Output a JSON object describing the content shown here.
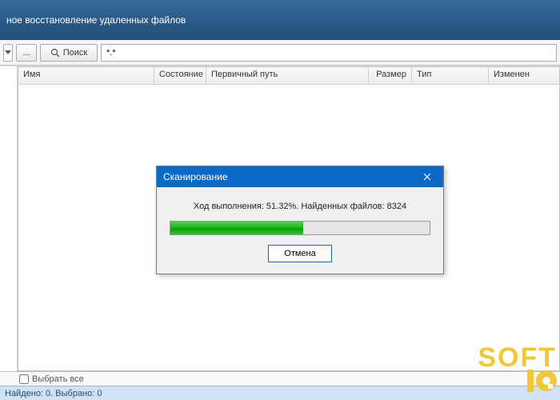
{
  "header": {
    "title": "ное восстановление удаленных файлов"
  },
  "toolbar": {
    "browse_label": "...",
    "search_label": "Поиск",
    "filter_value": "*.*"
  },
  "grid": {
    "columns": {
      "name": "Имя",
      "state": "Состояние",
      "path": "Первичный путь",
      "size": "Размер",
      "type": "Тип",
      "modified": "Изменен"
    }
  },
  "selectall": {
    "label": "Выбрать все",
    "checked": false
  },
  "status": {
    "text": "Найдено: 0. Выбрано: 0"
  },
  "dialog": {
    "title": "Сканирование",
    "progress_percent": 51.32,
    "found_count": 8324,
    "text": "Ход выполнения: 51.32%. Найденных файлов: 8324",
    "cancel_label": "Отмена"
  },
  "watermark": {
    "line1": "SOFT"
  }
}
